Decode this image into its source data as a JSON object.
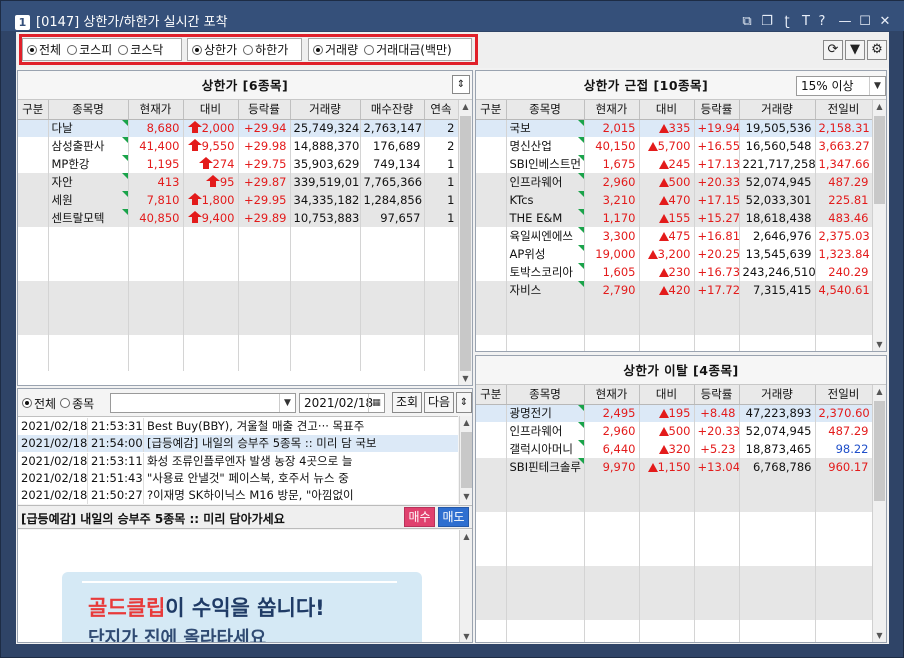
{
  "window": {
    "num_badge": "1",
    "title": "[0147] 상한가/하한가 실시간 포착",
    "controls": [
      "⧉",
      "⧉",
      "T̶",
      "T",
      "?",
      "—",
      "☐",
      "✕"
    ]
  },
  "filter": {
    "market_options": [
      "전체",
      "코스피",
      "코스닥"
    ],
    "market_selected": 0,
    "limit_options": [
      "상한가",
      "하한가"
    ],
    "limit_selected": 0,
    "sort_options": [
      "거래량",
      "거래대금(백만)"
    ],
    "sort_selected": 0,
    "refresh_icon": "⟳",
    "dropdown_icon": "▼",
    "settings_icon": "⚙"
  },
  "upper_limit": {
    "title": "상한가 [6종목]",
    "sort_icon": "⇕",
    "columns": [
      "구분",
      "종목명",
      "현재가",
      "대비",
      "등락률",
      "거래량",
      "매수잔량",
      "연속"
    ],
    "rows": [
      {
        "name": "다날",
        "price": "8,680",
        "diff": "2,000",
        "rate": "+29.94",
        "volume": "25,749,324",
        "bid": "2,763,147",
        "streak": "2"
      },
      {
        "name": "삼성출판사",
        "price": "41,400",
        "diff": "9,550",
        "rate": "+29.98",
        "volume": "14,888,370",
        "bid": "176,689",
        "streak": "2"
      },
      {
        "name": "MP한강",
        "price": "1,195",
        "diff": "274",
        "rate": "+29.75",
        "volume": "35,903,629",
        "bid": "749,134",
        "streak": "1"
      },
      {
        "name": "자안",
        "price": "413",
        "diff": "95",
        "rate": "+29.87",
        "volume": "339,519,016",
        "bid": "7,765,366",
        "streak": "1"
      },
      {
        "name": "세원",
        "price": "7,810",
        "diff": "1,800",
        "rate": "+29.95",
        "volume": "34,335,182",
        "bid": "1,284,856",
        "streak": "1"
      },
      {
        "name": "센트랄모텍",
        "price": "40,850",
        "diff": "9,400",
        "rate": "+29.89",
        "volume": "10,753,883",
        "bid": "97,657",
        "streak": "1"
      }
    ]
  },
  "near_limit": {
    "title": "상한가 근접 [10종목]",
    "threshold": "15% 이상",
    "columns": [
      "구분",
      "종목명",
      "현재가",
      "대비",
      "등락률",
      "거래량",
      "전일비"
    ],
    "rows": [
      {
        "name": "국보",
        "price": "2,015",
        "diff": "335",
        "rate": "+19.94",
        "volume": "19,505,536",
        "prev": "2,158.31"
      },
      {
        "name": "명신산업",
        "price": "40,150",
        "diff": "5,700",
        "rate": "+16.55",
        "volume": "16,560,548",
        "prev": "3,663.27"
      },
      {
        "name": "SBI인베스트먼",
        "price": "1,675",
        "diff": "245",
        "rate": "+17.13",
        "volume": "221,717,258",
        "prev": "1,347.66"
      },
      {
        "name": "인프라웨어",
        "price": "2,960",
        "diff": "500",
        "rate": "+20.33",
        "volume": "52,074,945",
        "prev": "487.29"
      },
      {
        "name": "KTcs",
        "price": "3,210",
        "diff": "470",
        "rate": "+17.15",
        "volume": "52,033,301",
        "prev": "225.81"
      },
      {
        "name": "THE E&M",
        "price": "1,170",
        "diff": "155",
        "rate": "+15.27",
        "volume": "18,618,438",
        "prev": "483.46"
      },
      {
        "name": "육일씨엔에쓰",
        "price": "3,300",
        "diff": "475",
        "rate": "+16.81",
        "volume": "2,646,976",
        "prev": "2,375.03"
      },
      {
        "name": "AP위성",
        "price": "19,000",
        "diff": "3,200",
        "rate": "+20.25",
        "volume": "13,545,639",
        "prev": "1,323.84"
      },
      {
        "name": "토박스코리아",
        "price": "1,605",
        "diff": "230",
        "rate": "+16.73",
        "volume": "243,246,510",
        "prev": "240.29"
      },
      {
        "name": "자비스",
        "price": "2,790",
        "diff": "420",
        "rate": "+17.72",
        "volume": "7,315,415",
        "prev": "4,540.61"
      }
    ]
  },
  "off_limit": {
    "title": "상한가 이탈 [4종목]",
    "columns": [
      "구분",
      "종목명",
      "현재가",
      "대비",
      "등락률",
      "거래량",
      "전일비"
    ],
    "rows": [
      {
        "name": "광명전기",
        "price": "2,495",
        "diff": "195",
        "rate": "+8.48",
        "volume": "47,223,893",
        "prev": "2,370.60",
        "prev_color": "red"
      },
      {
        "name": "인프라웨어",
        "price": "2,960",
        "diff": "500",
        "rate": "+20.33",
        "volume": "52,074,945",
        "prev": "487.29",
        "prev_color": "red"
      },
      {
        "name": "갤럭시아머니",
        "price": "6,440",
        "diff": "320",
        "rate": "+5.23",
        "volume": "18,873,465",
        "prev": "98.22",
        "prev_color": "blue"
      },
      {
        "name": "SBI핀테크솔루",
        "price": "9,970",
        "diff": "1,150",
        "rate": "+13.04",
        "volume": "6,768,786",
        "prev": "960.17",
        "prev_color": "red"
      }
    ]
  },
  "news": {
    "filter_options": [
      "전체",
      "종목"
    ],
    "filter_selected": 0,
    "date": "2021/02/18",
    "calendar_icon": "▦",
    "query_btn": "조회",
    "next_btn": "다음",
    "rows": [
      {
        "date": "2021/02/18",
        "time": "21:53:31",
        "text": "Best Buy(BBY), 겨울철 매출 견고··· 목표주"
      },
      {
        "date": "2021/02/18",
        "time": "21:54:00",
        "text": "[급등예감] 내일의 승부주 5종목 :: 미리 담 국보"
      },
      {
        "date": "2021/02/18",
        "time": "21:53:11",
        "text": "화성 조류인플루엔자 발생 농장 4곳으로 늘"
      },
      {
        "date": "2021/02/18",
        "time": "21:51:43",
        "text": "\"사용료 안낼것\" 페이스북, 호주서 뉴스 중"
      },
      {
        "date": "2021/02/18",
        "time": "21:50:27",
        "text": "?이재명 SK하이닉스 M16 방문, \"아낌없이"
      }
    ],
    "headline": "[급등예감] 내일의 승부주 5종목 :: 미리 담아가세요",
    "buy_btn": "매수",
    "sell_btn": "매도",
    "banner_red": "골드클립",
    "banner_text": "이 수익을 쏩니다!",
    "banner_sub": "단지가 진에 올라타세요"
  }
}
